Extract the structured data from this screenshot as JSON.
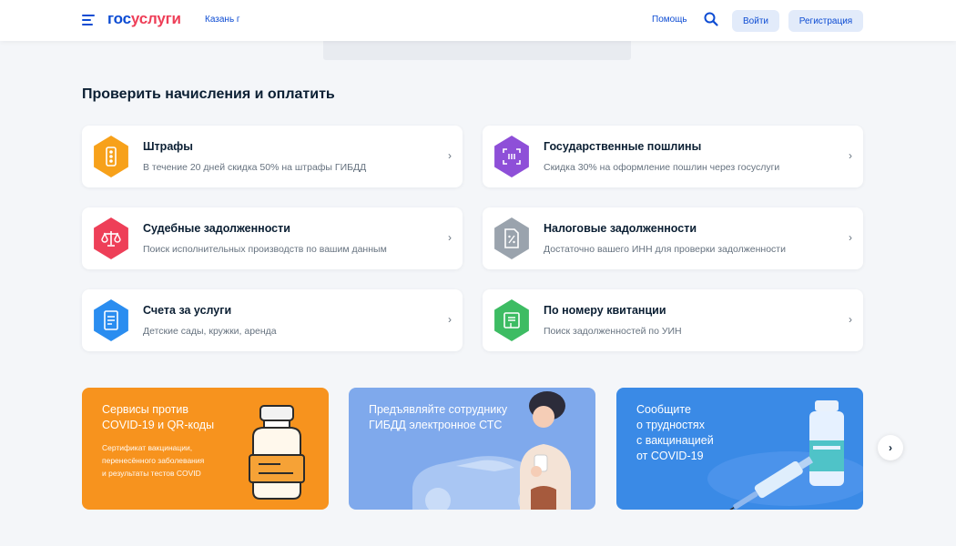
{
  "header": {
    "logo_part1": "гос",
    "logo_part2": "услуги",
    "city": "Казань г",
    "help": "Помощь",
    "login": "Войти",
    "register": "Регистрация"
  },
  "section": {
    "title": "Проверить начисления и оплатить"
  },
  "cards": [
    {
      "title": "Штрафы",
      "subtitle": "В течение 20 дней скидка 50% на штрафы ГИБДД",
      "icon": "traffic-light-icon",
      "color": "#f7a11a"
    },
    {
      "title": "Государственные пошлины",
      "subtitle": "Скидка 30% на оформление пошлин через госуслуги",
      "icon": "barcode-scan-icon",
      "color": "#8e4fd8"
    },
    {
      "title": "Судебные задолженности",
      "subtitle": "Поиск исполнительных производств по вашим данным",
      "icon": "scales-icon",
      "color": "#ee3f58"
    },
    {
      "title": "Налоговые задолженности",
      "subtitle": "Достаточно вашего ИНН для проверки задолженности",
      "icon": "tax-document-icon",
      "color": "#9aa3ad"
    },
    {
      "title": "Счета за услуги",
      "subtitle": "Детские сады, кружки, аренда",
      "icon": "invoice-icon",
      "color": "#2a8df0"
    },
    {
      "title": "По номеру квитанции",
      "subtitle": "Поиск задолженностей по УИН",
      "icon": "receipt-icon",
      "color": "#3dbc63"
    }
  ],
  "banners": [
    {
      "title_line1": "Сервисы против",
      "title_line2": "COVID-19 и QR-коды",
      "sub_line1": "Сертификат вакцинации,",
      "sub_line2": "перенесённого заболевания",
      "sub_line3": "и результаты тестов COVID",
      "color": "#f7931e"
    },
    {
      "title_line1": "Предъявляйте сотруднику",
      "title_line2": "ГИБДД электронное СТС",
      "color": "#7fa9ec"
    },
    {
      "title_line1": "Сообщите",
      "title_line2": "о трудностях",
      "title_line3": "с вакцинацией",
      "title_line4": "от COVID-19",
      "color": "#3a8ae6"
    }
  ],
  "carousel": {
    "next_icon": "chevron-right-icon"
  }
}
